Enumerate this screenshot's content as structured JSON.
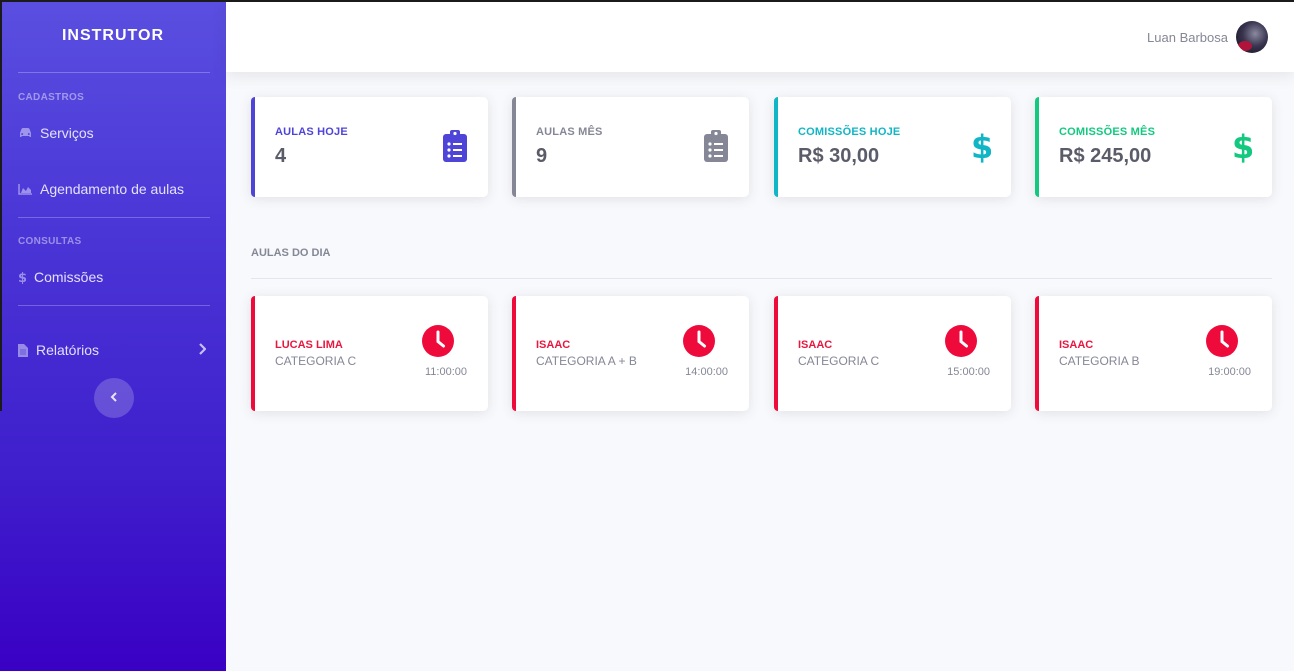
{
  "sidebar": {
    "brand": "INSTRUTOR",
    "sections": [
      {
        "heading": "CADASTROS"
      },
      {
        "heading": "CONSULTAS"
      }
    ],
    "items": [
      {
        "label": "Serviços",
        "icon": "car-icon"
      },
      {
        "label": "Agendamento de aulas",
        "icon": "chart-area-icon"
      },
      {
        "label": "Comissões",
        "icon": "dollar-icon"
      },
      {
        "label": "Relatórios",
        "icon": "file-icon"
      }
    ],
    "toggle_icon": "chevron-left-icon"
  },
  "topbar": {
    "user_name": "Luan Barbosa"
  },
  "stats": [
    {
      "label": "AULAS HOJE",
      "value": "4",
      "color": "#4e44d8",
      "icon": "clipboard-list-icon"
    },
    {
      "label": "AULAS MÊS",
      "value": "9",
      "color": "#858796",
      "icon": "clipboard-list-icon"
    },
    {
      "label": "COMISSÕES HOJE",
      "value": "R$ 30,00",
      "color": "#11b6c6",
      "icon": "dollar-sign-icon"
    },
    {
      "label": "COMISSÕES MÊS",
      "value": "R$ 245,00",
      "color": "#13c97f",
      "icon": "dollar-sign-icon"
    }
  ],
  "lessons_section": {
    "title": "AULAS DO DIA"
  },
  "lessons": [
    {
      "student": "LUCAS LIMA",
      "category": "CATEGORIA C",
      "time": "11:00:00"
    },
    {
      "student": "ISAAC",
      "category": "CATEGORIA A + B",
      "time": "14:00:00"
    },
    {
      "student": "ISAAC",
      "category": "CATEGORIA C",
      "time": "15:00:00"
    },
    {
      "student": "ISAAC",
      "category": "CATEGORIA B",
      "time": "19:00:00"
    }
  ],
  "colors": {
    "accent": "#4e44d8",
    "danger": "#ef0a3c",
    "sidebar_top": "#5a4fe0",
    "sidebar_bottom": "#3a00c4"
  }
}
